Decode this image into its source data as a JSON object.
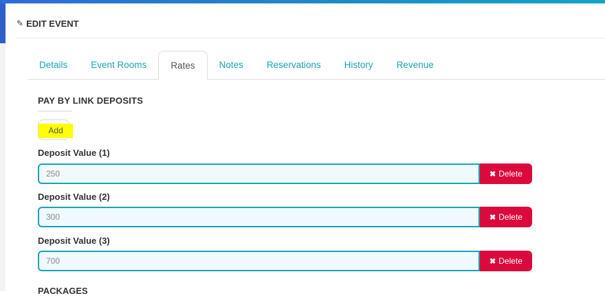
{
  "header": {
    "title": "EDIT EVENT",
    "icon": "pencil-icon"
  },
  "tabs": [
    {
      "label": "Details",
      "active": false
    },
    {
      "label": "Event Rooms",
      "active": false
    },
    {
      "label": "Rates",
      "active": true
    },
    {
      "label": "Notes",
      "active": false
    },
    {
      "label": "Reservations",
      "active": false
    },
    {
      "label": "History",
      "active": false
    },
    {
      "label": "Revenue",
      "active": false
    }
  ],
  "deposits": {
    "section_title": "PAY BY LINK DEPOSITS",
    "add_label": "Add",
    "items": [
      {
        "label": "Deposit Value (1)",
        "value": "250",
        "delete_label": "Delete"
      },
      {
        "label": "Deposit Value (2)",
        "value": "300",
        "delete_label": "Delete"
      },
      {
        "label": "Deposit Value (3)",
        "value": "700",
        "delete_label": "Delete"
      }
    ]
  },
  "packages": {
    "title": "PACKAGES"
  },
  "colors": {
    "accent": "#1aa3b5",
    "danger": "#dc0a3c",
    "highlight": "#ffff00",
    "input_background": "#f0f9fd"
  }
}
